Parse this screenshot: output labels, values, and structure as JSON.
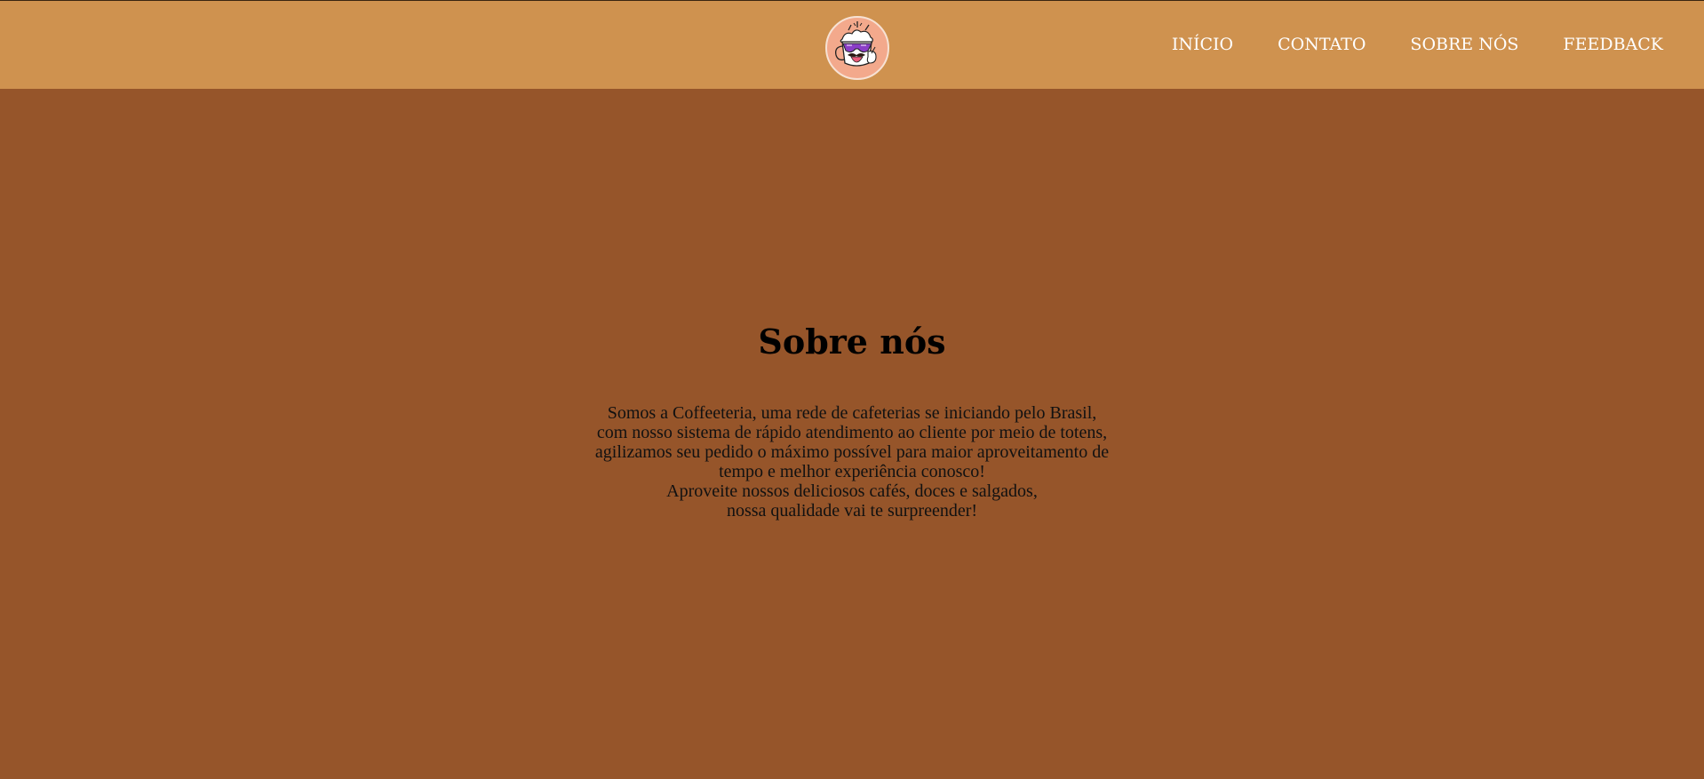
{
  "header": {
    "logo_alt": "Coffeeteria mascot",
    "nav": [
      {
        "label": "INÍCIO"
      },
      {
        "label": "CONTATO"
      },
      {
        "label": "SOBRE NÓS"
      },
      {
        "label": "FEEDBACK"
      }
    ]
  },
  "about": {
    "title": "Sobre nós",
    "lines": [
      "Somos a Coffeeteria, uma rede de cafeterias se iniciando pelo Brasil,",
      "com nosso sistema de rápido atendimento ao cliente por meio de totens,",
      "agilizamos seu pedido o máximo possível para maior aproveitamento de",
      "tempo e melhor experiência conosco!",
      "Aproveite nossos deliciosos cafés, doces e salgados,",
      "nossa qualidade vai te surpreender!"
    ]
  },
  "colors": {
    "header_bg": "#cf924f",
    "page_bg": "#96552a",
    "nav_text": "#ffffff",
    "logo_bg": "#f3a98c"
  }
}
